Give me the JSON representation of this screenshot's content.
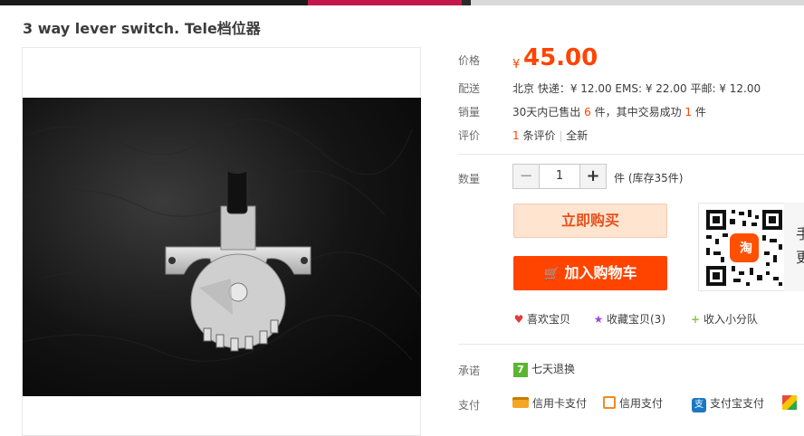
{
  "page": {
    "title": "3 way lever switch. Tele档位器"
  },
  "price": {
    "label": "价格",
    "currency": "¥",
    "value": "45.00"
  },
  "shipping": {
    "label": "配送",
    "text": "北京  快递：¥ 12.00   EMS: ¥ 22.00   平邮: ¥ 12.00"
  },
  "sales": {
    "label": "销量",
    "prefix": "30天内已售出",
    "sold": "6",
    "mid": "件，其中交易成功",
    "success": "1",
    "suffix": "件"
  },
  "reviews": {
    "label": "评价",
    "count": "1",
    "count_suffix": "条评价",
    "sep": "|",
    "full": "全新"
  },
  "quantity": {
    "label": "数量",
    "minus": "−",
    "value": "1",
    "plus": "+",
    "unit": "件 (库存35件)"
  },
  "buttons": {
    "buy_now": "立即购买",
    "cart_icon": "🛒",
    "add_to_cart": "加入购物车"
  },
  "qr": {
    "badge": "淘",
    "side_text_1": "手",
    "side_text_2": "更"
  },
  "actions": {
    "like": "喜欢宝贝",
    "collect": "收藏宝贝(3)",
    "team": "收入小分队"
  },
  "promise": {
    "label": "承诺",
    "badge": "7",
    "text": "七天退换"
  },
  "payment": {
    "label": "支付",
    "credit_card": "信用卡支付",
    "credit": "信用支付",
    "alipay_badge": "支",
    "alipay": "支付宝支付"
  },
  "colors": {
    "accent": "#ff4400",
    "buy_bg": "#ffe4d0",
    "cart_bg": "#ff4400",
    "promise_badge": "#5cb531"
  },
  "icons": {
    "cart": "cart-icon",
    "like": "heart-icon",
    "collect": "star-icon",
    "team": "plus-icon",
    "promise": "seven-day-icon",
    "credit_card": "credit-card-icon",
    "credit": "credit-pay-icon",
    "alipay": "alipay-icon"
  }
}
